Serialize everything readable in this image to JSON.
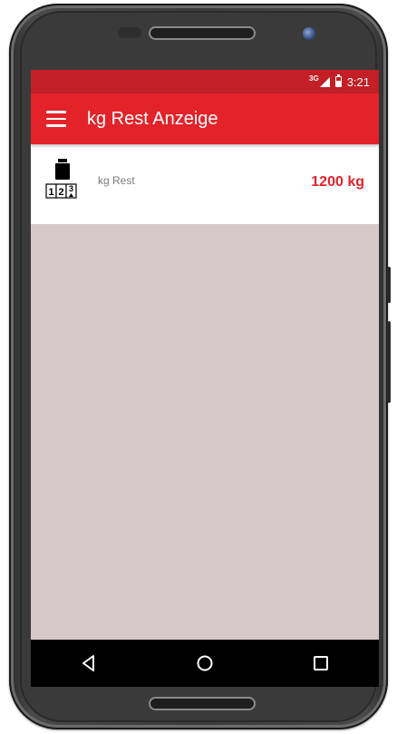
{
  "status_bar": {
    "network": "3G",
    "time": "3:21"
  },
  "app_bar": {
    "title": "kg Rest Anzeige"
  },
  "card": {
    "label": "kg Rest",
    "value": "1200 kg",
    "icon_digits": [
      "1",
      "2",
      "3"
    ]
  },
  "icons": {
    "menu": "hamburger-menu-icon",
    "weight": "weight-counter-icon",
    "back": "back-triangle-icon",
    "home": "home-circle-icon",
    "recents": "recents-square-icon"
  },
  "colors": {
    "primary": "#e3222a",
    "status_bar": "#c21f26",
    "content_bg": "#d6c7c8",
    "value_text": "#e3222a"
  }
}
